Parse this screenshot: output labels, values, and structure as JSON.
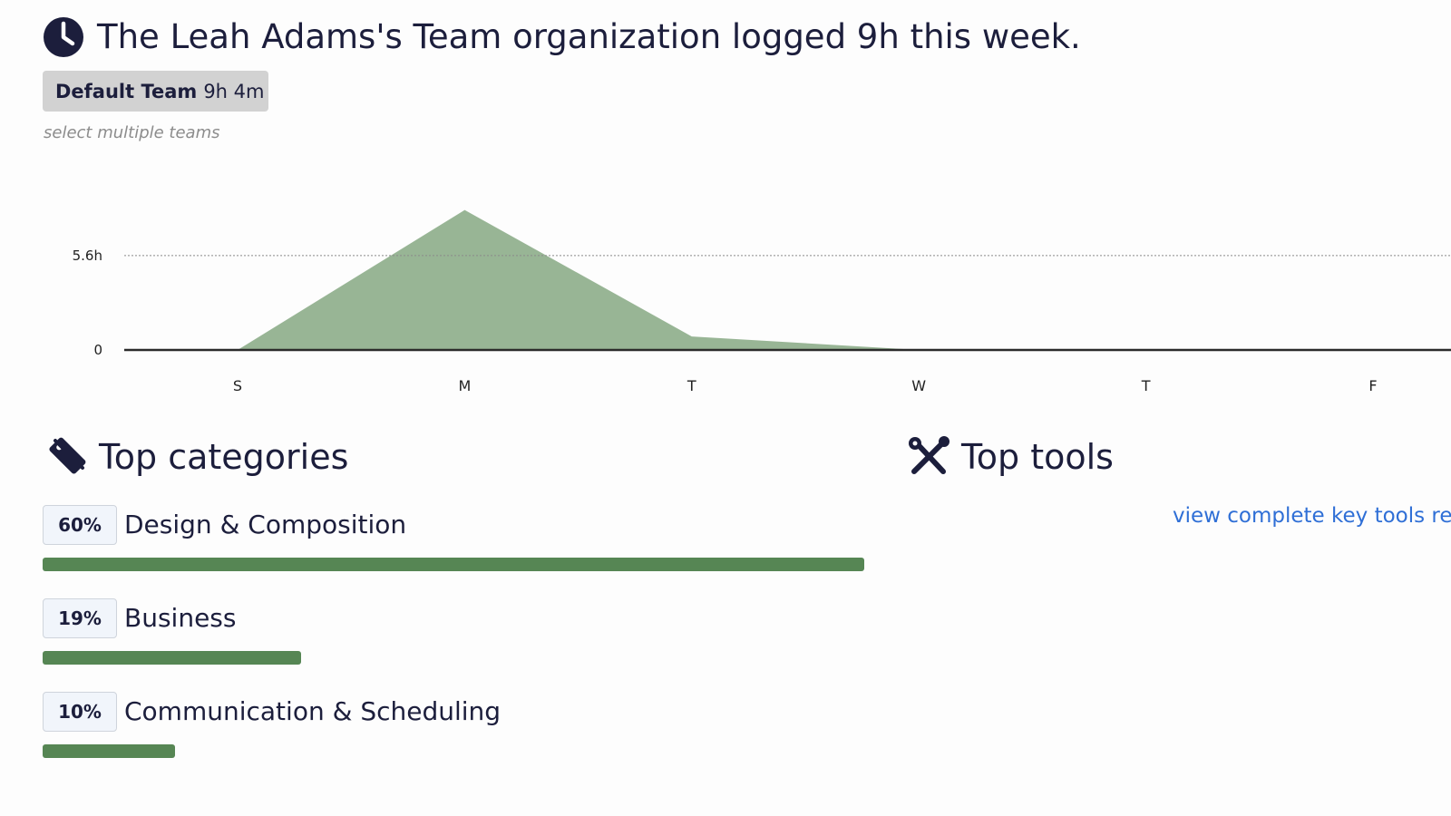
{
  "header": {
    "title": "The Leah Adams's Team organization logged 9h this week.",
    "icon": "clock-icon"
  },
  "team_filter": {
    "team_name": "Default Team",
    "team_time": "9h 4m",
    "select_multiple_label": "select multiple teams"
  },
  "chart_data": {
    "type": "area",
    "categories": [
      "S",
      "M",
      "T",
      "W",
      "T",
      "F"
    ],
    "values": [
      0,
      8.3,
      0.8,
      0,
      0,
      0
    ],
    "y_ticks": [
      {
        "value": 0,
        "label": "0"
      },
      {
        "value": 5.6,
        "label": "5.6h"
      }
    ],
    "grid": "dotted reference line at 5.6h",
    "color": "#98b595",
    "axis_color": "#2b2b2b"
  },
  "top_categories": {
    "title": "Top categories",
    "icon": "tags-icon",
    "items": [
      {
        "pct": "60%",
        "name": "Design & Composition",
        "fraction": 1.0
      },
      {
        "pct": "19%",
        "name": "Business",
        "fraction": 0.315
      },
      {
        "pct": "10%",
        "name": "Communication & Scheduling",
        "fraction": 0.161
      }
    ],
    "bar_color": "#568654"
  },
  "top_tools": {
    "title": "Top tools",
    "icon": "tools-icon",
    "link": "view complete key tools re"
  }
}
